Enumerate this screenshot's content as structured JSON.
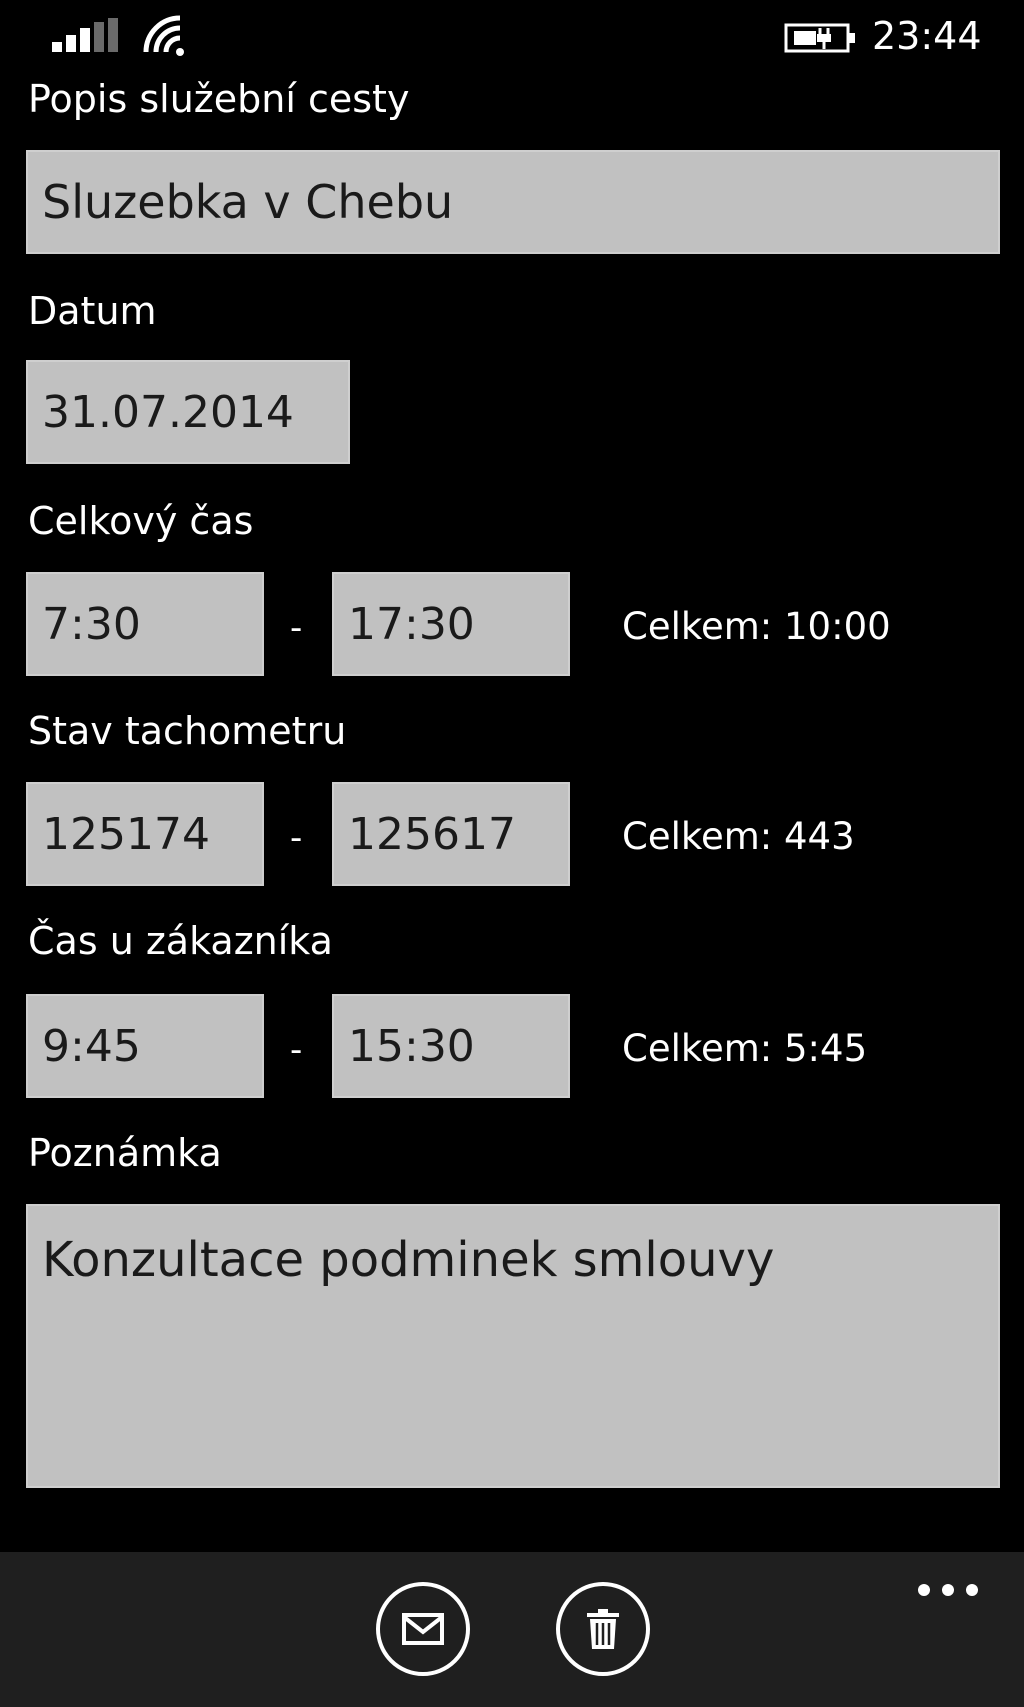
{
  "status_bar": {
    "time": "23:44",
    "icons": [
      "signal-icon",
      "wifi-icon",
      "battery-charging-icon"
    ]
  },
  "form": {
    "description": {
      "label": "Popis služební cesty",
      "value": "Sluzebka v Chebu"
    },
    "date": {
      "label": "Datum",
      "value": "31.07.2014"
    },
    "total_time": {
      "label": "Celkový čas",
      "from": "7:30",
      "separator": "-",
      "to": "17:30",
      "total": "Celkem: 10:00"
    },
    "odometer": {
      "label": "Stav tachometru",
      "from": "125174",
      "separator": "-",
      "to": "125617",
      "total": "Celkem: 443"
    },
    "customer_time": {
      "label": "Čas u zákazníka",
      "from": "9:45",
      "separator": "-",
      "to": "15:30",
      "total": "Celkem: 5:45"
    },
    "note": {
      "label": "Poznámka",
      "value": "Konzultace podminek smlouvy"
    }
  },
  "app_bar": {
    "buttons": [
      "mail-icon",
      "trash-icon"
    ],
    "more": "more-icon",
    "background": "#1f1f1f"
  },
  "colors": {
    "background": "#000000",
    "input_background": "#c1c1c1",
    "text": "#ffffff"
  }
}
